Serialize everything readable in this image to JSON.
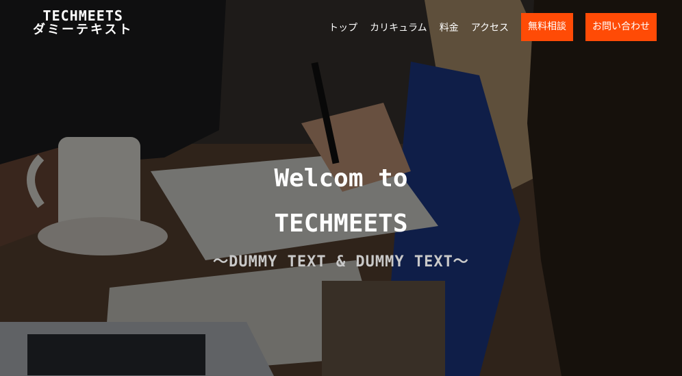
{
  "header": {
    "logo_line1": "TECHMEETS",
    "logo_line2": "ダミーテキスト",
    "nav": [
      {
        "label": "トップ"
      },
      {
        "label": "カリキュラム"
      },
      {
        "label": "料金"
      },
      {
        "label": "アクセス"
      }
    ],
    "cta_buttons": [
      {
        "label": "無料相談"
      },
      {
        "label": "お問い合わせ"
      }
    ]
  },
  "hero": {
    "line1": "Welcom to",
    "line2": "TECHMEETS",
    "subtitle": "〜DUMMY TEXT & DUMMY TEXT〜"
  },
  "colors": {
    "accent": "#ff4b06",
    "text": "#ffffff",
    "subtitle": "#c9c9c9"
  }
}
